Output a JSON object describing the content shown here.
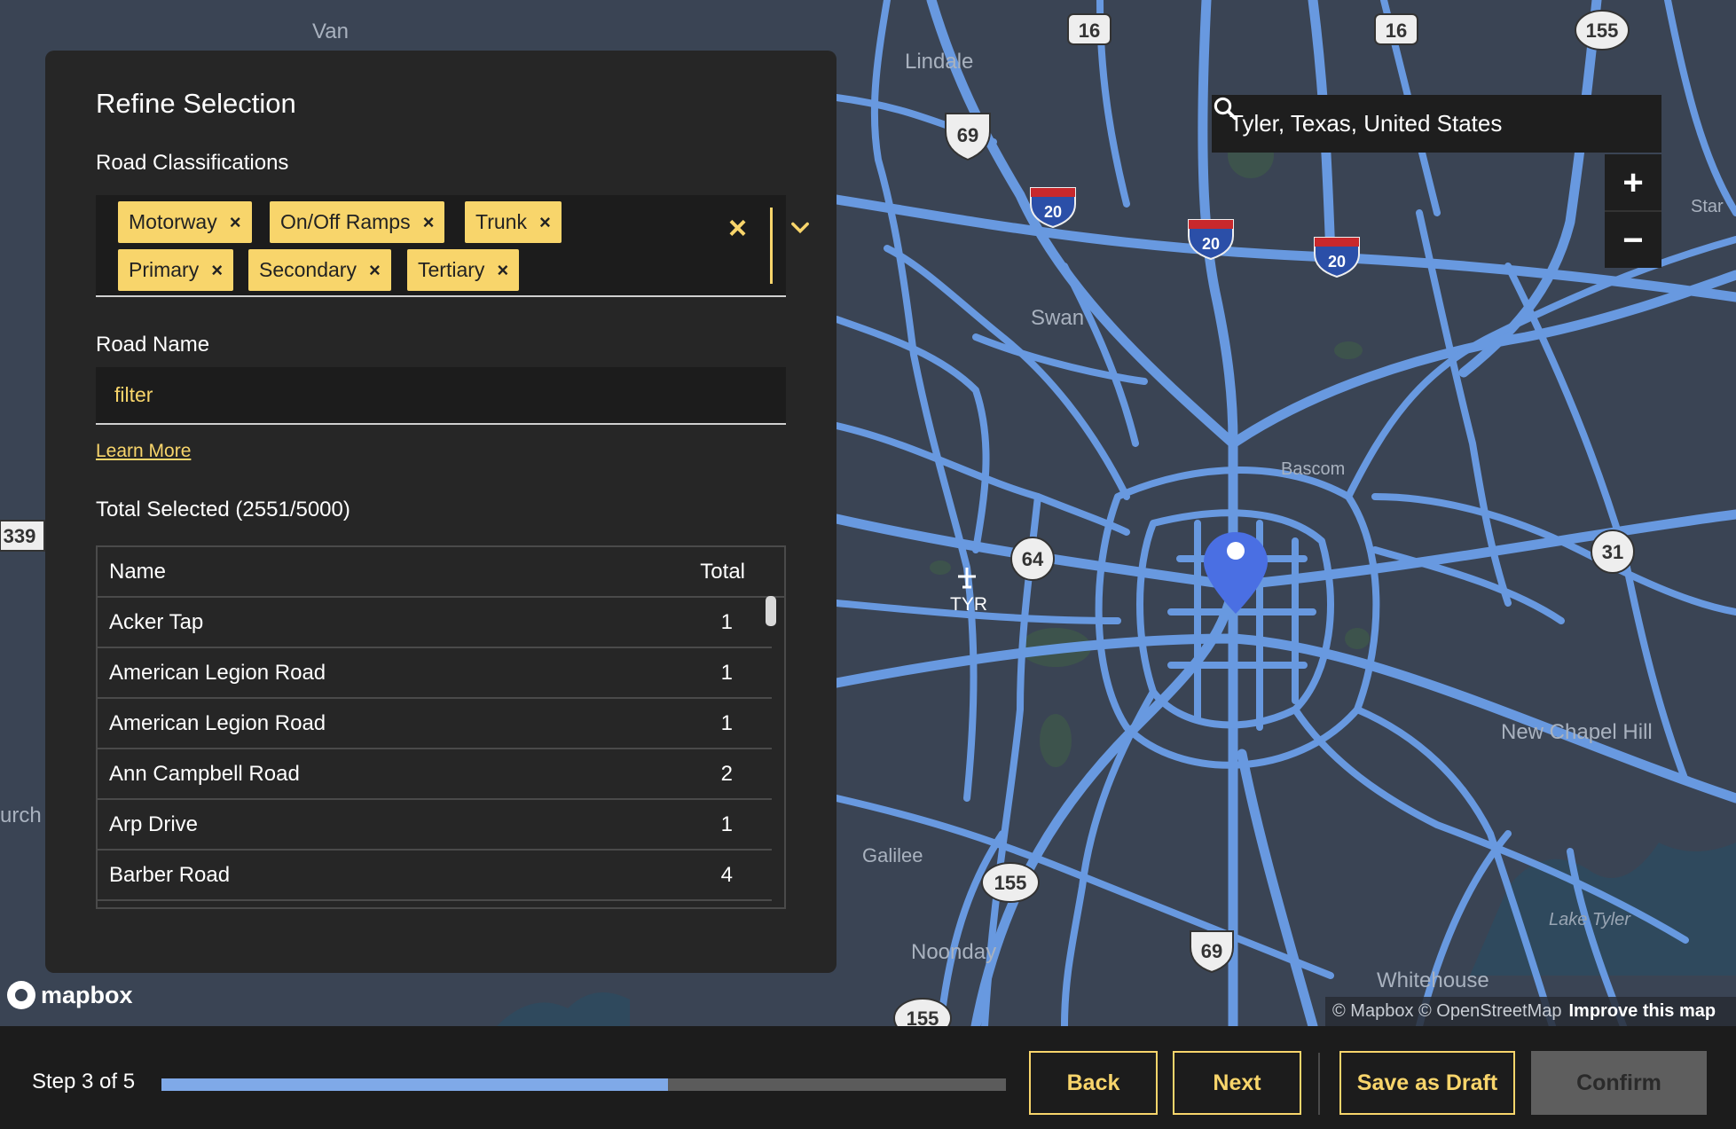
{
  "map": {
    "place_labels": [
      "Van",
      "Lindale",
      "Swan",
      "Bascom",
      "Galilee",
      "Noonday",
      "New Chapel Hill",
      "Whitehouse",
      "Lake Tyler",
      "urch",
      "Star",
      "TYR"
    ],
    "route_shields": [
      "16",
      "16",
      "155",
      "69",
      "20",
      "20",
      "20",
      "64",
      "31",
      "155",
      "69",
      "155",
      "339"
    ],
    "search": {
      "value": "Tyler, Texas, United States"
    },
    "zoom": {
      "in": "+",
      "out": "−"
    },
    "logo_text": "mapbox",
    "attribution": {
      "text": "© Mapbox © OpenStreetMap",
      "improve": "Improve this map"
    },
    "colors": {
      "roads": "#6b9ee8",
      "background": "#3a4454",
      "marker": "#4a6fe3"
    }
  },
  "panel": {
    "title": "Refine Selection",
    "classifications_label": "Road Classifications",
    "chips": [
      "Motorway",
      "On/Off Ramps",
      "Trunk",
      "Primary",
      "Secondary",
      "Tertiary"
    ],
    "chip_remove": "×",
    "clear": "×",
    "road_name_label": "Road Name",
    "road_name_value": "filter",
    "learn_more": "Learn More",
    "total_selected": "Total Selected (2551/5000)",
    "table": {
      "headers": {
        "name": "Name",
        "total": "Total"
      },
      "rows": [
        {
          "name": "Acker Tap",
          "total": "1"
        },
        {
          "name": "American Legion Road",
          "total": "1"
        },
        {
          "name": "American Legion Road",
          "total": "1"
        },
        {
          "name": "Ann Campbell Road",
          "total": "2"
        },
        {
          "name": "Arp Drive",
          "total": "1"
        },
        {
          "name": "Barber Road",
          "total": "4"
        }
      ]
    }
  },
  "footer": {
    "step": "Step 3 of 5",
    "progress": 0.6,
    "back": "Back",
    "next": "Next",
    "save_draft": "Save as Draft",
    "confirm": "Confirm"
  },
  "colors": {
    "accent": "#f8d56b",
    "panel": "#262626",
    "progress": "#7fa9e8"
  }
}
